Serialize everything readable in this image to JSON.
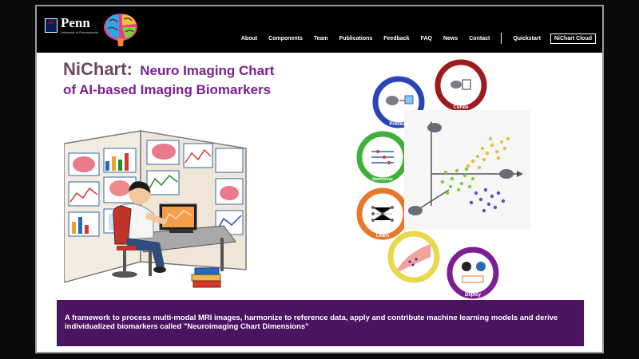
{
  "header": {
    "logo_text": "Penn",
    "logo_subtext": "University of Pennsylvania",
    "nav_items": [
      "About",
      "Components",
      "Team",
      "Publications",
      "Feedback",
      "FAQ",
      "News",
      "Contact"
    ],
    "quickstart_label": "Quickstart",
    "cloud_button_label": "NiChart Cloud"
  },
  "hero": {
    "brand": "NiChart:",
    "title": "Neuro Imaging Chart of AI-based Imaging Biomarkers"
  },
  "cycle": {
    "stages": [
      "Process",
      "Curate",
      "Harmonize",
      "Learn",
      "Deploy"
    ],
    "colors": {
      "process": "#2b45b8",
      "curate": "#9b1c1c",
      "harmonize": "#3db13a",
      "learn": "#e8772e",
      "interpret": "#e8d84a",
      "deploy": "#7b1f93"
    }
  },
  "banner": {
    "text": "A framework to process multi-modal MRI images, harmonize to reference data, apply and contribute machine learning models and derive individualized biomarkers called \"Neuroimaging Chart Dimensions\""
  },
  "colors": {
    "accent": "#7b1f93",
    "banner_bg": "#4a1460",
    "topbar": "#000000"
  }
}
